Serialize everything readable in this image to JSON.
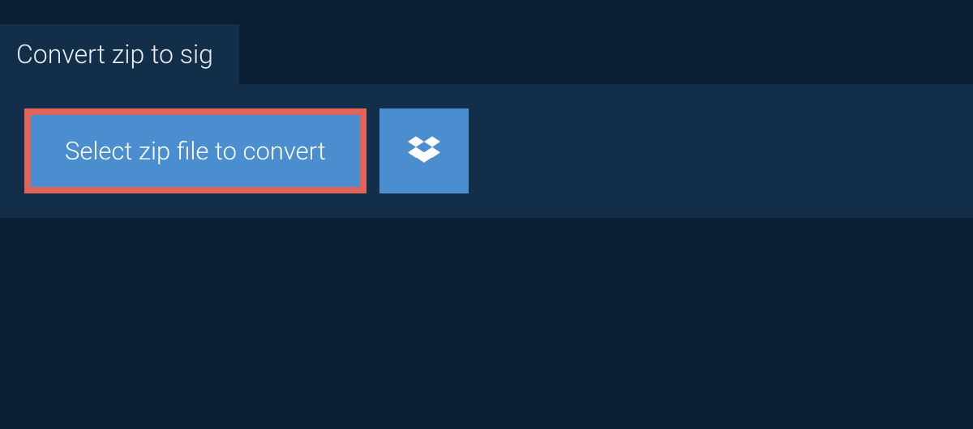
{
  "tab": {
    "title": "Convert zip to sig"
  },
  "actions": {
    "select_label": "Select zip file to convert",
    "dropbox_icon": "dropbox"
  },
  "colors": {
    "background": "#0b1e33",
    "panel": "#132e48",
    "button": "#4b8ecf",
    "highlight_border": "#e0645a",
    "text_light": "#ffffff"
  }
}
